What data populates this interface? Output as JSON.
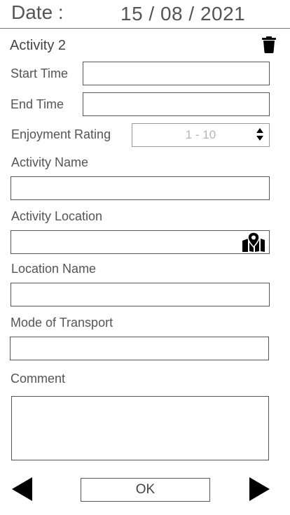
{
  "header": {
    "date_label": "Date :",
    "date_value": "15 / 08 / 2021"
  },
  "activity": {
    "title": "Activity 2",
    "delete_icon": "trash-icon"
  },
  "fields": {
    "start_time": {
      "label": "Start Time",
      "value": ""
    },
    "end_time": {
      "label": "End Time",
      "value": ""
    },
    "enjoyment_rating": {
      "label": "Enjoyment Rating",
      "value": "1 - 10",
      "icon": "updown-arrows-icon"
    },
    "activity_name": {
      "label": "Activity Name",
      "value": ""
    },
    "activity_location": {
      "label": "Activity Location",
      "value": "",
      "icon": "map-pin-icon"
    },
    "location_name": {
      "label": "Location Name",
      "value": ""
    },
    "mode_of_transport": {
      "label": "Mode of Transport",
      "value": ""
    },
    "comment": {
      "label": "Comment",
      "value": ""
    }
  },
  "footer": {
    "prev_icon": "triangle-left-icon",
    "ok_label": "OK",
    "next_icon": "triangle-right-icon"
  },
  "colors": {
    "text": "#444444",
    "border": "#555555",
    "placeholder": "#b5b5b5",
    "icon": "#000000"
  }
}
